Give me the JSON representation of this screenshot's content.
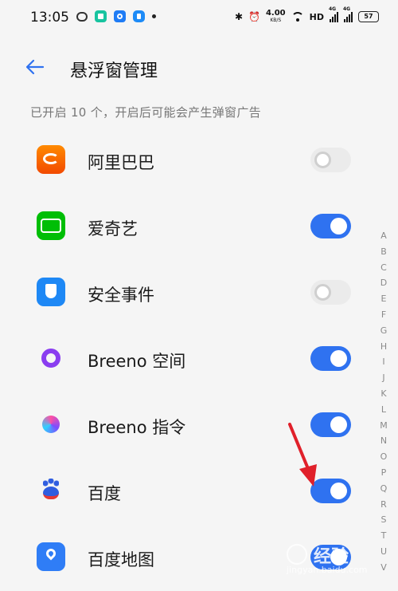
{
  "status_bar": {
    "time": "13:05",
    "speed_value": "4.00",
    "speed_unit": "KB/S",
    "network": "HD",
    "signal1_label": "4G",
    "signal2_label": "4G",
    "battery": "57"
  },
  "header": {
    "title": "悬浮窗管理"
  },
  "subtitle": "已开启 10 个，开启后可能会产生弹窗广告",
  "apps": [
    {
      "label": "阿里巴巴",
      "icon": "alibaba-icon",
      "enabled": false
    },
    {
      "label": "爱奇艺",
      "icon": "iqiyi-icon",
      "enabled": true
    },
    {
      "label": "安全事件",
      "icon": "security-events-icon",
      "enabled": false
    },
    {
      "label": "Breeno 空间",
      "icon": "breeno-space-icon",
      "enabled": true
    },
    {
      "label": "Breeno 指令",
      "icon": "breeno-command-icon",
      "enabled": true
    },
    {
      "label": "百度",
      "icon": "baidu-icon",
      "enabled": true
    },
    {
      "label": "百度地图",
      "icon": "baidu-map-icon",
      "enabled": true
    }
  ],
  "index_letters": [
    "A",
    "B",
    "C",
    "D",
    "E",
    "F",
    "G",
    "H",
    "I",
    "J",
    "K",
    "L",
    "M",
    "N",
    "O",
    "P",
    "Q",
    "R",
    "S",
    "T",
    "U",
    "V"
  ],
  "watermark": {
    "text": "经验",
    "url": "jingyan.baidu.com"
  },
  "colors": {
    "accent": "#2f72f0",
    "annotation_arrow": "#e0202a"
  }
}
